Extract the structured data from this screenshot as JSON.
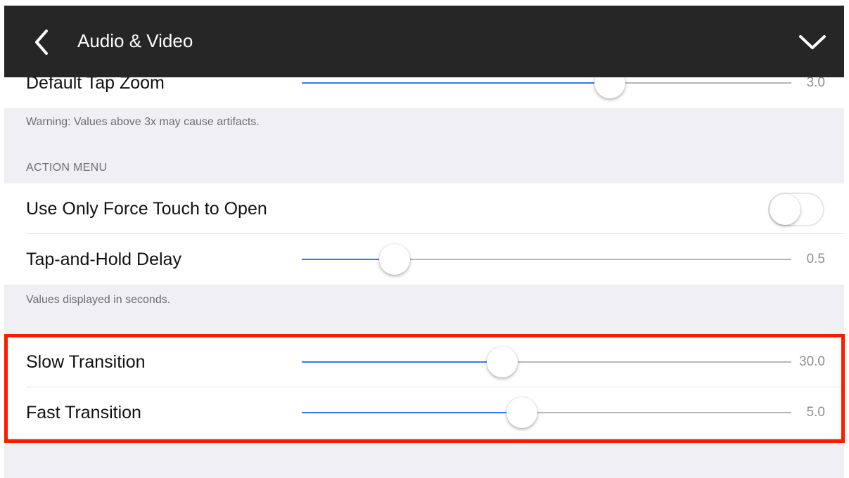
{
  "header": {
    "title": "Audio & Video",
    "back_icon": "chevron-left-icon",
    "collapse_icon": "chevron-down-icon",
    "background_color": "#262626"
  },
  "default_tap_zoom": {
    "label": "Default Tap Zoom",
    "value_text": "3.0",
    "fraction": 0.63
  },
  "warning_text": "Warning: Values above 3x may cause artifacts.",
  "action_menu": {
    "section_title": "ACTION MENU",
    "force_touch": {
      "label": "Use Only Force Touch to Open",
      "enabled": false
    },
    "tap_hold_delay": {
      "label": "Tap-and-Hold Delay",
      "value_text": "0.5",
      "fraction": 0.19
    },
    "footer": "Values displayed in seconds."
  },
  "transitions": {
    "slow": {
      "label": "Slow Transition",
      "value_text": "30.0",
      "fraction": 0.41
    },
    "fast": {
      "label": "Fast Transition",
      "value_text": "5.0",
      "fraction": 0.45
    }
  },
  "colors": {
    "accent": "#3478f6",
    "highlight": "#ff1a00",
    "grouped_background": "#efeff4"
  }
}
